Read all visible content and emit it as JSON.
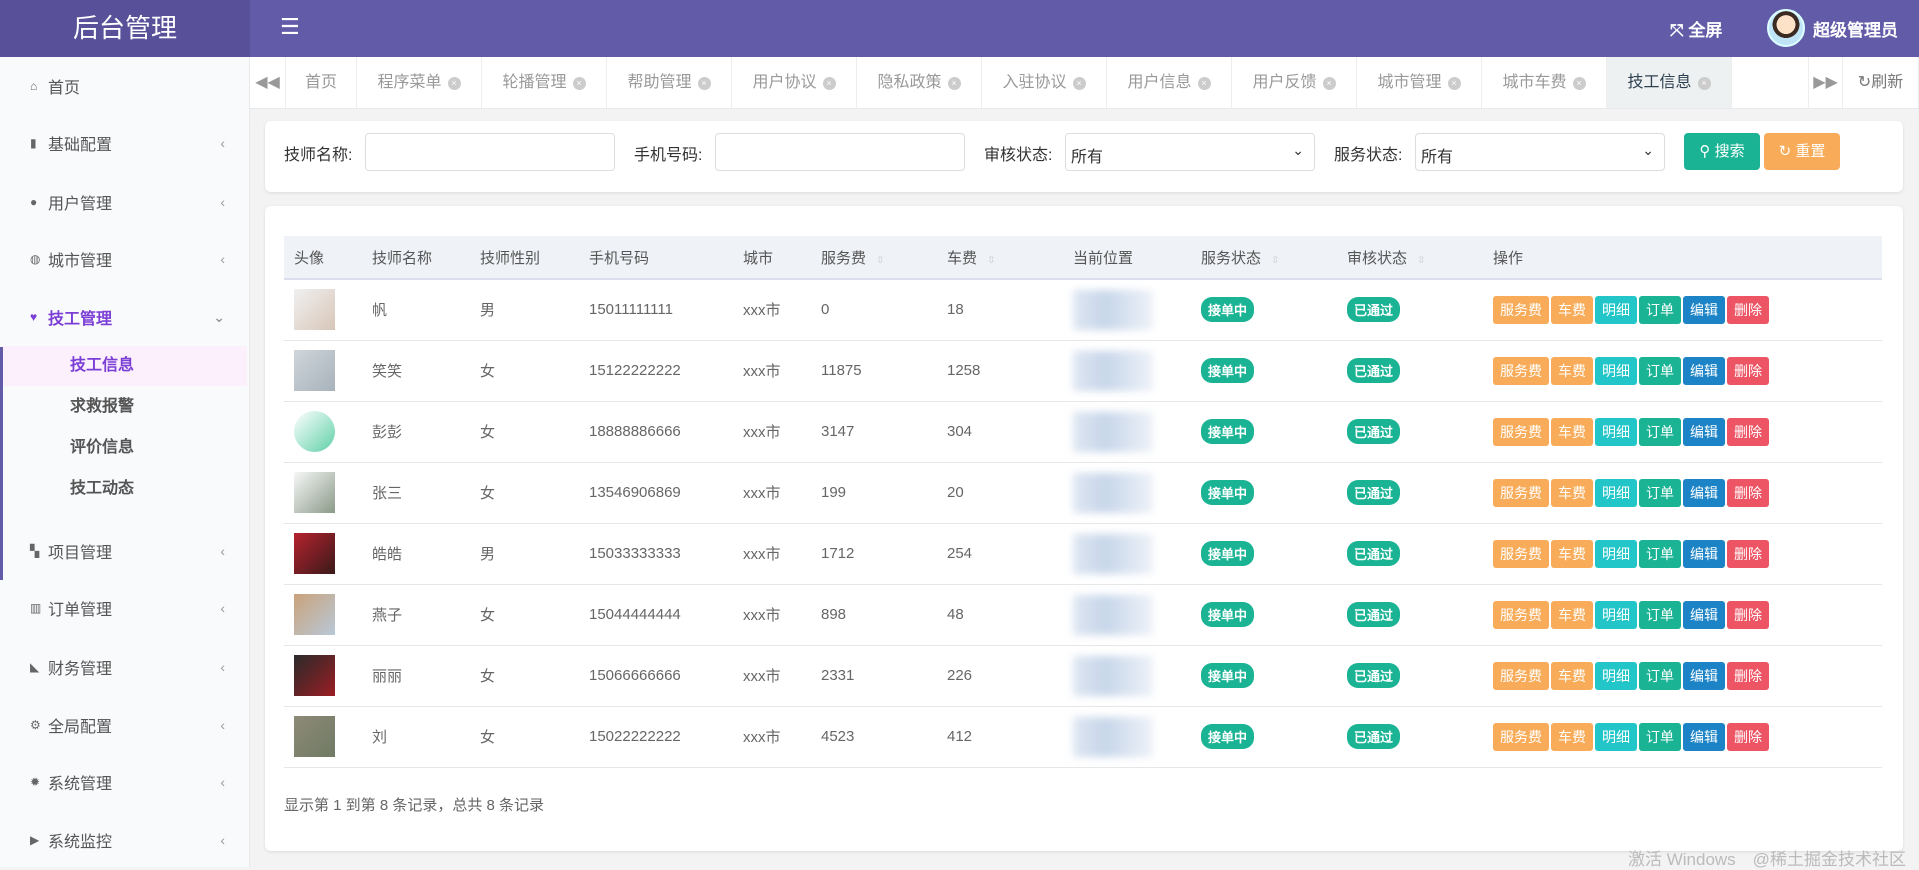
{
  "header": {
    "logo": "后台管理",
    "menu_icon": "☰",
    "fullscreen": "全屏",
    "user": "超级管理员"
  },
  "sidebar": {
    "items": [
      {
        "label": "首页",
        "icon": "⌂"
      },
      {
        "label": "基础配置",
        "icon": "▮"
      },
      {
        "label": "用户管理",
        "icon": "●"
      },
      {
        "label": "城市管理",
        "icon": "◍"
      },
      {
        "label": "技工管理",
        "icon": "♥"
      },
      {
        "label": "项目管理",
        "icon": "▚"
      },
      {
        "label": "订单管理",
        "icon": "▥"
      },
      {
        "label": "财务管理",
        "icon": "◣"
      },
      {
        "label": "全局配置",
        "icon": "⚙"
      },
      {
        "label": "系统管理",
        "icon": "✹"
      },
      {
        "label": "系统监控",
        "icon": "▶"
      }
    ],
    "sub": [
      "技工信息",
      "求救报警",
      "评价信息",
      "技工动态"
    ]
  },
  "tabs": {
    "items": [
      "首页",
      "程序菜单",
      "轮播管理",
      "帮助管理",
      "用户协议",
      "隐私政策",
      "入驻协议",
      "用户信息",
      "用户反馈",
      "城市管理",
      "城市车费",
      "技工信息"
    ],
    "refresh": "刷新"
  },
  "search": {
    "name_label": "技师名称:",
    "phone_label": "手机号码:",
    "audit_label": "审核状态:",
    "audit_value": "所有",
    "service_label": "服务状态:",
    "service_value": "所有",
    "search_btn": "搜索",
    "reset_btn": "重置"
  },
  "table": {
    "headers": [
      "头像",
      "技师名称",
      "技师性别",
      "手机号码",
      "城市",
      "服务费",
      "车费",
      "当前位置",
      "服务状态",
      "审核状态",
      "操作"
    ],
    "rows": [
      {
        "name": "帆",
        "gender": "男",
        "phone": "15011111111",
        "city": "xxx市",
        "fee": "0",
        "car": "18",
        "status": "接单中",
        "audit": "已通过"
      },
      {
        "name": "笑笑",
        "gender": "女",
        "phone": "15122222222",
        "city": "xxx市",
        "fee": "11875",
        "car": "1258",
        "status": "接单中",
        "audit": "已通过"
      },
      {
        "name": "彭彭",
        "gender": "女",
        "phone": "18888886666",
        "city": "xxx市",
        "fee": "3147",
        "car": "304",
        "status": "接单中",
        "audit": "已通过"
      },
      {
        "name": "张三",
        "gender": "女",
        "phone": "13546906869",
        "city": "xxx市",
        "fee": "199",
        "car": "20",
        "status": "接单中",
        "audit": "已通过"
      },
      {
        "name": "皓皓",
        "gender": "男",
        "phone": "15033333333",
        "city": "xxx市",
        "fee": "1712",
        "car": "254",
        "status": "接单中",
        "audit": "已通过"
      },
      {
        "name": "燕子",
        "gender": "女",
        "phone": "15044444444",
        "city": "xxx市",
        "fee": "898",
        "car": "48",
        "status": "接单中",
        "audit": "已通过"
      },
      {
        "name": "丽丽",
        "gender": "女",
        "phone": "15066666666",
        "city": "xxx市",
        "fee": "2331",
        "car": "226",
        "status": "接单中",
        "audit": "已通过"
      },
      {
        "name": "刘",
        "gender": "女",
        "phone": "15022222222",
        "city": "xxx市",
        "fee": "4523",
        "car": "412",
        "status": "接单中",
        "audit": "已通过"
      }
    ],
    "actions": [
      "服务费",
      "车费",
      "明细",
      "订单",
      "编辑",
      "删除"
    ],
    "footer": "显示第 1 到第 8 条记录，总共 8 条记录"
  },
  "watermark": "激活 Windows　@稀土掘金技术社区",
  "colors": {
    "header": "#625ba8",
    "primary": "#1ab394",
    "warning": "#f8ac59",
    "info": "#23c6c8",
    "blue": "#1c84c6",
    "danger": "#ed5565"
  }
}
